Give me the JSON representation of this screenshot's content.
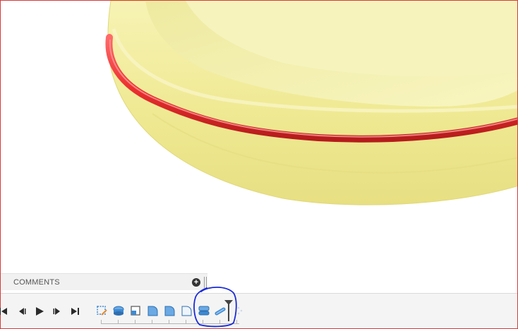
{
  "comments": {
    "label": "COMMENTS"
  },
  "timeline": {
    "controls": [
      "go-to-start-icon",
      "step-back-icon",
      "play-icon",
      "step-forward-icon",
      "go-to-end-icon"
    ],
    "features": [
      "sketch-icon",
      "extrude-icon",
      "split-body-icon",
      "fillet-icon",
      "fillet-icon",
      "fillet-icon",
      "shell-icon",
      "pipe-icon"
    ]
  },
  "colors": {
    "body": "#f3ef9a",
    "ring": "#ec2f2f",
    "annotation": "#1a2bd6",
    "feature": "#3d8ad3"
  }
}
